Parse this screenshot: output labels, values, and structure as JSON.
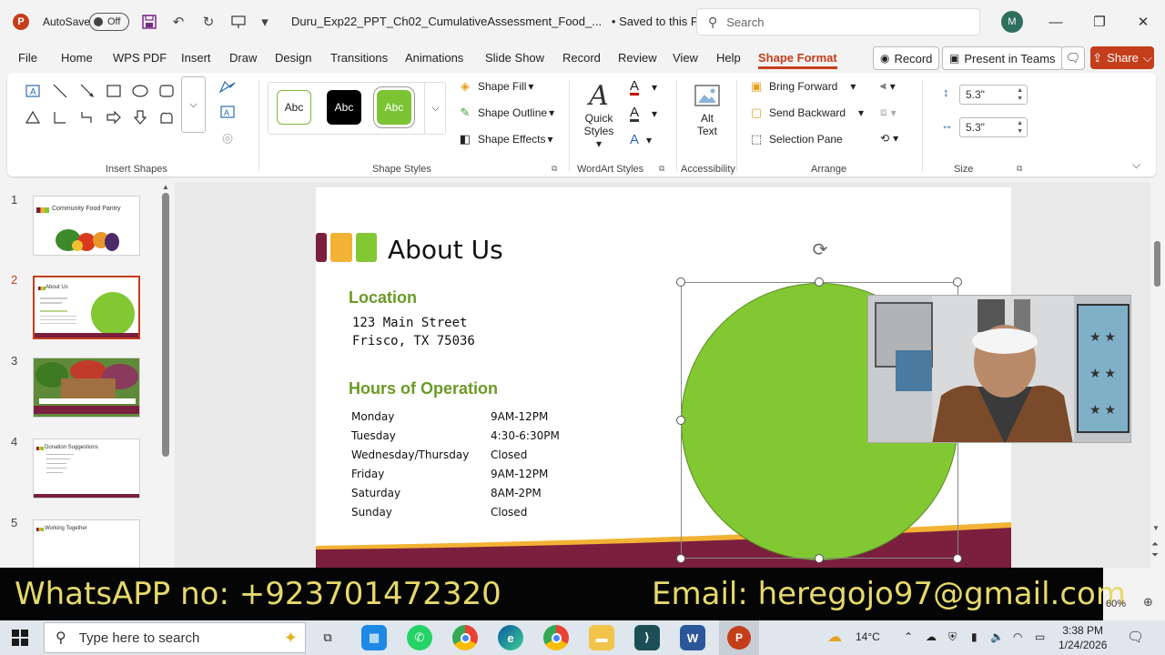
{
  "titlebar": {
    "app_icon": "P",
    "autosave_label": "AutoSave",
    "autosave_state": "Off",
    "filename": "Duru_Exp22_PPT_Ch02_CumulativeAssessment_Food_...",
    "save_status": "• Saved to this PC",
    "search_placeholder": "Search",
    "avatar_initial": "M",
    "icons": [
      "save-icon",
      "undo-icon",
      "redo-icon",
      "present-from-start-icon",
      "customize-qat-icon"
    ]
  },
  "menu": {
    "tabs": [
      "File",
      "Home",
      "WPS PDF",
      "Insert",
      "Draw",
      "Design",
      "Transitions",
      "Animations",
      "Slide Show",
      "Record",
      "Review",
      "View",
      "Help",
      "Shape Format"
    ],
    "active_tab": "Shape Format",
    "record_label": "Record",
    "present_label": "Present in Teams",
    "share_label": "Share"
  },
  "ribbon": {
    "insert_shapes_label": "Insert Shapes",
    "shape_styles_label": "Shape Styles",
    "style_tiles": [
      "Abc",
      "Abc",
      "Abc"
    ],
    "shape_fill": "Shape Fill",
    "shape_outline": "Shape Outline",
    "shape_effects": "Shape Effects",
    "quick_styles_1": "Quick",
    "quick_styles_2": "Styles",
    "wordart_label": "WordArt Styles",
    "alt_text_1": "Alt",
    "alt_text_2": "Text",
    "accessibility_label": "Accessibility",
    "bring_forward": "Bring Forward",
    "send_backward": "Send Backward",
    "selection_pane": "Selection Pane",
    "arrange_label": "Arrange",
    "height_value": "5.3\"",
    "width_value": "5.3\"",
    "size_label": "Size"
  },
  "slides": {
    "numbers": [
      "1",
      "2",
      "3",
      "4",
      "5"
    ],
    "thumb_titles": [
      "Community Food Pantry",
      "About Us",
      "",
      "Donation Suggestions",
      "Working Together"
    ]
  },
  "slide": {
    "title": "About Us",
    "location_heading": "Location",
    "address_line1": "123 Main Street",
    "address_line2": "Frisco, TX 75036",
    "hours_heading": "Hours of Operation",
    "hours": [
      {
        "day": "Monday",
        "time": "9AM-12PM"
      },
      {
        "day": "Tuesday",
        "time": "4:30-6:30PM"
      },
      {
        "day": "Wednesday/Thursday",
        "time": "Closed"
      },
      {
        "day": "Friday",
        "time": "9AM-12PM"
      },
      {
        "day": "Saturday",
        "time": "8AM-2PM"
      },
      {
        "day": "Sunday",
        "time": "Closed"
      }
    ],
    "colors": {
      "green": "#82c832",
      "burgundy": "#7a1f3d",
      "gold": "#f2b233"
    }
  },
  "banner": {
    "whatsapp": "WhatsAPP no: +923701472320",
    "email": "Email: heregojo97@gmail.com"
  },
  "statusbar": {
    "zoom": "60%"
  },
  "taskbar": {
    "search_placeholder": "Type here to search",
    "weather": "14°C",
    "time": "3:38 PM",
    "date": "1/24/2026"
  }
}
